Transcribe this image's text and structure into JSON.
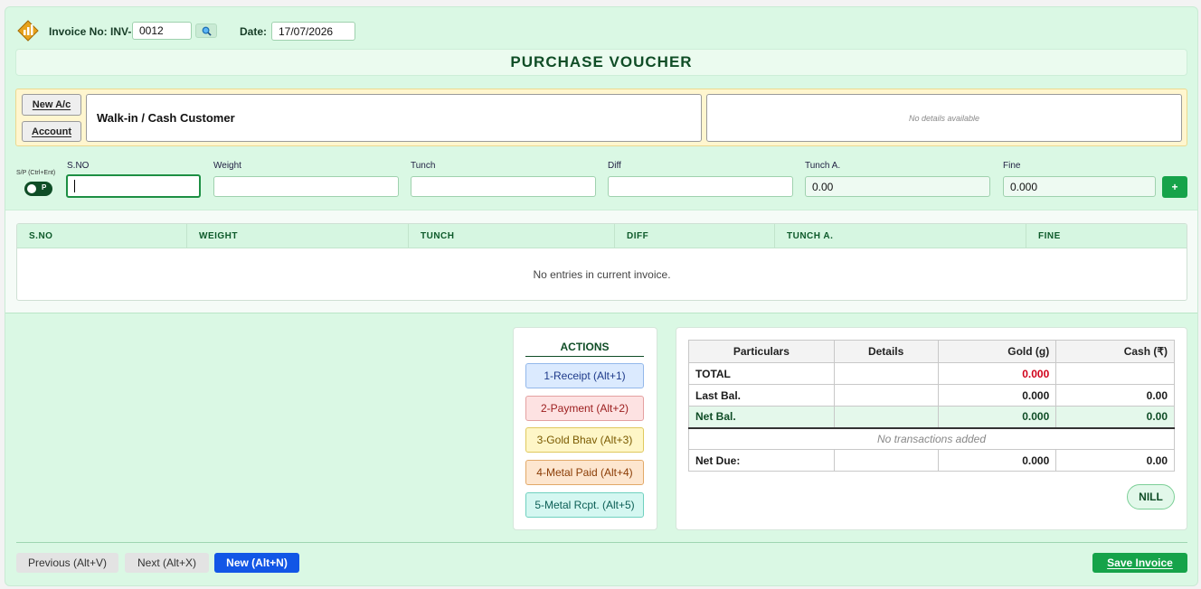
{
  "header": {
    "invoice_label": "Invoice No: INV-",
    "invoice_value": "0012",
    "date_label": "Date:",
    "date_value": "17/07/2026",
    "search_icon": "search-icon"
  },
  "title": "PURCHASE VOUCHER",
  "account": {
    "new_ac_label": "New A/c",
    "account_label": "Account",
    "customer_name": "Walk-in / Cash Customer",
    "details_text": "No details available"
  },
  "entry": {
    "toggle_label": "S/P (Ctrl+Ent)",
    "toggle_value": "P",
    "fields": {
      "sno_label": "S.NO",
      "sno_value": "",
      "weight_label": "Weight",
      "weight_value": "",
      "tunch_label": "Tunch",
      "tunch_value": "",
      "diff_label": "Diff",
      "diff_value": "",
      "tuncha_label": "Tunch A.",
      "tuncha_value": "0.00",
      "fine_label": "Fine",
      "fine_value": "0.000"
    },
    "add_label": "+"
  },
  "grid": {
    "columns": [
      "S.NO",
      "WEIGHT",
      "TUNCH",
      "DIFF",
      "TUNCH A.",
      "FINE"
    ],
    "empty_text": "No entries in current invoice."
  },
  "actions": {
    "title": "ACTIONS",
    "buttons": [
      {
        "label": "1-Receipt (Alt+1)"
      },
      {
        "label": "2-Payment (Alt+2)"
      },
      {
        "label": "3-Gold Bhav (Alt+3)"
      },
      {
        "label": "4-Metal Paid (Alt+4)"
      },
      {
        "label": "5-Metal Rcpt. (Alt+5)"
      }
    ]
  },
  "summary": {
    "headers": [
      "Particulars",
      "Details",
      "Gold (g)",
      "Cash (₹)"
    ],
    "total_label": "TOTAL",
    "total_gold": "0.000",
    "total_cash": "",
    "last_label": "Last Bal.",
    "last_gold": "0.000",
    "last_cash": "0.00",
    "net_label": "Net Bal.",
    "net_gold": "0.000",
    "net_cash": "0.00",
    "no_tx": "No transactions added",
    "due_label": "Net Due:",
    "due_gold": "0.000",
    "due_cash": "0.00",
    "nill_label": "NILL"
  },
  "footer": {
    "prev_label": "Previous (Alt+V)",
    "next_label": "Next (Alt+X)",
    "new_label": "New (Alt+N)",
    "save_label": "Save Invoice"
  },
  "colors": {
    "page_bg": "#daf8e4",
    "accent_green": "#0f9a3e",
    "new_blue": "#1256e6",
    "total_red": "#d0021b"
  }
}
